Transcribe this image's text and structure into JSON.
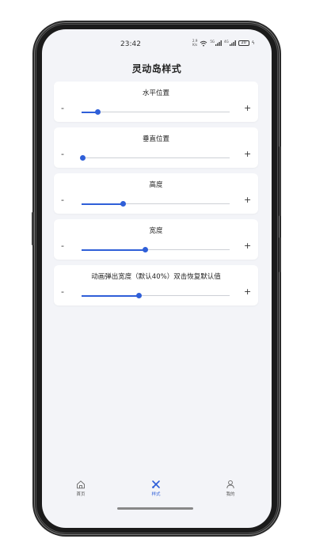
{
  "status_bar": {
    "time": "23:42",
    "speed_value": "2.9",
    "speed_unit": "K/s",
    "net_tag_1": "5G",
    "net_tag_2": "4G",
    "battery": "20"
  },
  "page_title": "灵动岛样式",
  "sliders": [
    {
      "title": "水平位置",
      "minus": "-",
      "plus": "+",
      "value_fraction": 0.11
    },
    {
      "title": "垂直位置",
      "minus": "-",
      "plus": "+",
      "value_fraction": 0.01
    },
    {
      "title": "高度",
      "minus": "-",
      "plus": "+",
      "value_fraction": 0.28
    },
    {
      "title": "宽度",
      "minus": "-",
      "plus": "+",
      "value_fraction": 0.43
    },
    {
      "title": "动画弹出宽度（默认40%）双击恢复默认值",
      "minus": "-",
      "plus": "+",
      "value_fraction": 0.39
    }
  ],
  "tab_bar": {
    "tabs": [
      {
        "label": "首页",
        "icon": "home-icon",
        "active": false
      },
      {
        "label": "样式",
        "icon": "style-icon",
        "active": true
      },
      {
        "label": "我的",
        "icon": "person-icon",
        "active": false
      }
    ]
  },
  "colors": {
    "accent": "#2f5fd8",
    "background": "#f3f4f8",
    "card": "#ffffff"
  }
}
